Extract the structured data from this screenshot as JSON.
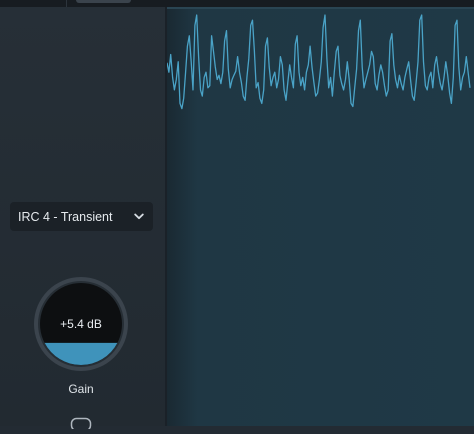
{
  "module": {
    "mode_dropdown": {
      "selected": "IRC 4 - Transient",
      "icon": "chevron-down-icon"
    },
    "gain_knob": {
      "value_text": "+5.4 dB",
      "label": "Gain",
      "level": 0.27
    },
    "link_icon": "link-icon"
  },
  "waveform_display": {
    "waveform_color": "#4aa3c7",
    "background_color": "#1f3946",
    "points": [
      0.46,
      0.55,
      0.38,
      0.6,
      0.72,
      0.62,
      0.45,
      0.85,
      0.9,
      0.8,
      0.55,
      0.3,
      0.2,
      0.45,
      0.72,
      0.1,
      0.0,
      0.4,
      0.72,
      0.78,
      0.6,
      0.55,
      0.7,
      0.68,
      0.2,
      0.35,
      0.5,
      0.62,
      0.58,
      0.66,
      0.55,
      0.25,
      0.15,
      0.52,
      0.7,
      0.62,
      0.58,
      0.54,
      0.4,
      0.55,
      0.65,
      0.78,
      0.82,
      0.6,
      0.42,
      0.1,
      0.05,
      0.35,
      0.7,
      0.65,
      0.8,
      0.85,
      0.72,
      0.3,
      0.22,
      0.5,
      0.68,
      0.6,
      0.55,
      0.7,
      0.62,
      0.4,
      0.48,
      0.72,
      0.82,
      0.65,
      0.48,
      0.6,
      0.7,
      0.28,
      0.2,
      0.55,
      0.68,
      0.6,
      0.72,
      0.55,
      0.48,
      0.3,
      0.5,
      0.65,
      0.78,
      0.75,
      0.62,
      0.45,
      0.12,
      0.0,
      0.42,
      0.7,
      0.6,
      0.78,
      0.55,
      0.35,
      0.3,
      0.58,
      0.66,
      0.72,
      0.62,
      0.45,
      0.62,
      0.85,
      0.88,
      0.7,
      0.52,
      0.15,
      0.05,
      0.5,
      0.7,
      0.62,
      0.55,
      0.48,
      0.35,
      0.4,
      0.66,
      0.72,
      0.58,
      0.48,
      0.55,
      0.68,
      0.78,
      0.72,
      0.25,
      0.18,
      0.48,
      0.62,
      0.7,
      0.58,
      0.66,
      0.72,
      0.6,
      0.52,
      0.45,
      0.62,
      0.78,
      0.82,
      0.65,
      0.45,
      0.05,
      0.0,
      0.45,
      0.68,
      0.72,
      0.6,
      0.55,
      0.7,
      0.48,
      0.4,
      0.55,
      0.66,
      0.72,
      0.6,
      0.45,
      0.58,
      0.75,
      0.85,
      0.6,
      0.1,
      0.05,
      0.5,
      0.72,
      0.6,
      0.55,
      0.4,
      0.55,
      0.7
    ]
  }
}
